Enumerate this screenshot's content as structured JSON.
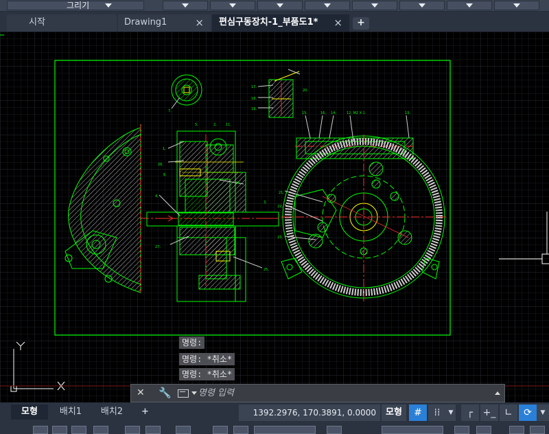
{
  "ribbon": {
    "draw_label": "그리기"
  },
  "tabs": {
    "start": "시작",
    "drawing1": "Drawing1",
    "active": "편심구동장치-1_부품도1*",
    "add": "+",
    "close": "×"
  },
  "command_history": [
    "명령:",
    "명령: *취소*",
    "명령: *취소*"
  ],
  "command_line": {
    "placeholder": "명령 입력"
  },
  "layout_tabs": {
    "model": "모형",
    "layout1": "배치1",
    "layout2": "배치2",
    "add": "+"
  },
  "status": {
    "coordinates": "1392.2976, 170.3891, 0.0000",
    "space": "모형"
  },
  "ucs": {
    "y_label": "Y",
    "x_label": "X"
  },
  "colors": {
    "canvas": "#000000",
    "drawing": "#00ff00",
    "center_line": "#ff3030",
    "highlight": "#ffff00",
    "ui_dark": "#2b3240",
    "active_toggle": "#2a7fd6"
  }
}
